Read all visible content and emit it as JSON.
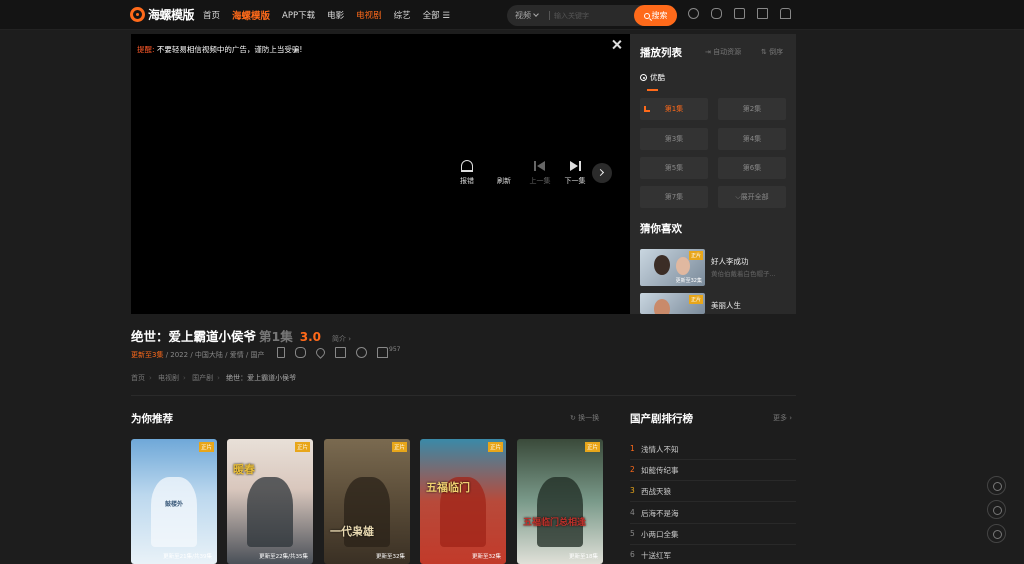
{
  "header": {
    "logo_text": "海螺模版",
    "nav": [
      "首页",
      "海螺模版",
      "APP下载",
      "电影",
      "电视剧",
      "综艺",
      "全部 ☰"
    ],
    "search_type": "视频",
    "search_placeholder": "输入关键字",
    "search_button": "搜索",
    "icons": [
      "history-icon",
      "chat-icon",
      "box-icon",
      "document-icon",
      "user-icon"
    ]
  },
  "player": {
    "warning_label": "提醒:",
    "warning_text": "不要轻易相信视频中的广告，谨防上当受骗!",
    "controls": {
      "report": "报错",
      "refresh": "刷新",
      "prev": "上一集",
      "next": "下一集"
    }
  },
  "playlist": {
    "title": "播放列表",
    "auto_source": "自动资源",
    "reverse": "倒序",
    "source_name": "优酷",
    "episodes": [
      "第1集",
      "第2集",
      "第3集",
      "第4集",
      "第5集",
      "第6集",
      "第7集",
      "⌵展开全部"
    ],
    "guess_title": "猜你喜欢",
    "guess": [
      {
        "name": "好人李成功",
        "desc": "黄伯伯戴着白色帽子...",
        "tag": "正片",
        "cap": "更新至32集"
      },
      {
        "name": "美丽人生",
        "desc": "",
        "tag": "正片",
        "cap": ""
      }
    ]
  },
  "detail": {
    "title": "绝世：爱上霸道小侯爷",
    "episode": "第1集",
    "score": "3.0",
    "intro": "简介 ›",
    "update": "更新至3集",
    "meta": " / 2022 / 中国大陆 / 爱情 / 国产",
    "likes": "957",
    "breadcrumb": [
      "首页",
      "电视剧",
      "国产剧",
      "绝世：爱上霸道小侯爷"
    ]
  },
  "recommend": {
    "title": "为你推荐",
    "refresh": "换一换",
    "cards": [
      {
        "badge": "正片",
        "art_text": "鼓楼外",
        "ep": "更新至21集/共39集"
      },
      {
        "badge": "正片",
        "art_text": "暖春",
        "ep": "更新至22集/共35集"
      },
      {
        "badge": "正片",
        "art_text": "一代枭雄",
        "ep": "更新至32集"
      },
      {
        "badge": "正片",
        "art_text": "五福临门",
        "ep": "更新至32集"
      },
      {
        "badge": "正片",
        "art_text": "五福临门总相逢",
        "ep": "更新至18集"
      }
    ]
  },
  "ranking": {
    "title": "国产剧排行榜",
    "more": "更多 ›",
    "items": [
      {
        "num": "1",
        "name": "浅情人不知"
      },
      {
        "num": "2",
        "name": "如懿传纪事"
      },
      {
        "num": "3",
        "name": "西战天狼"
      },
      {
        "num": "4",
        "name": "后海不是海"
      },
      {
        "num": "5",
        "name": "小两口全集"
      },
      {
        "num": "6",
        "name": "十送红军"
      }
    ]
  }
}
